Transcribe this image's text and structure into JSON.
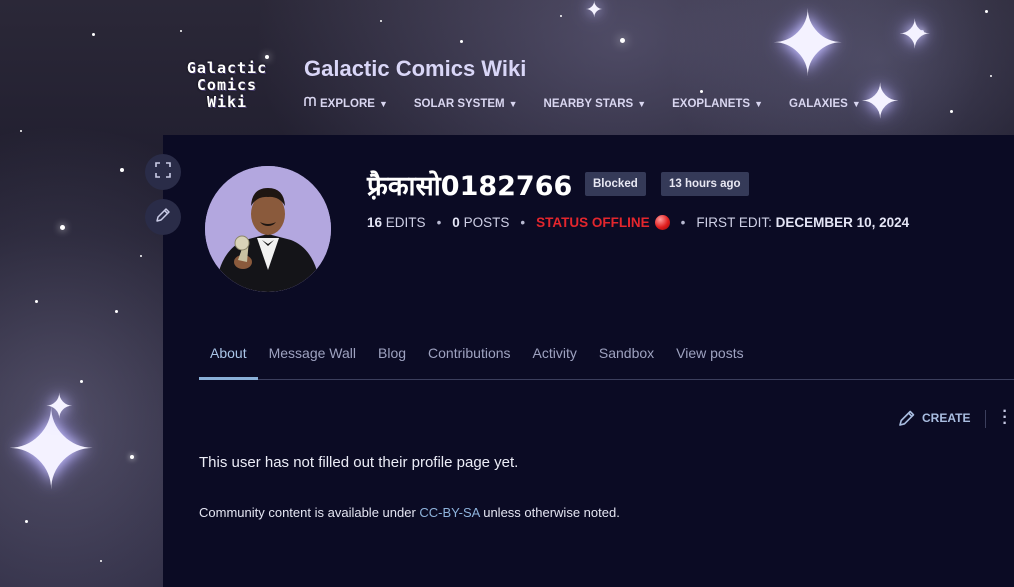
{
  "logo": {
    "line1": "Galactic",
    "line2": "Comics",
    "line3": "Wiki"
  },
  "site": {
    "title": "Galactic Comics Wiki"
  },
  "nav": {
    "items": [
      {
        "label": "EXPLORE",
        "icon": "explore-icon"
      },
      {
        "label": "SOLAR SYSTEM"
      },
      {
        "label": "NEARBY STARS"
      },
      {
        "label": "EXOPLANETS"
      },
      {
        "label": "GALAXIES"
      }
    ]
  },
  "profile": {
    "username": "फ़्रैकासो0182766",
    "badges": [
      "Blocked",
      "13 hours ago"
    ],
    "edits_count": "16",
    "edits_label": "EDITS",
    "posts_count": "0",
    "posts_label": "POSTS",
    "status": "STATUS OFFLINE",
    "status_color": "#e3262d",
    "first_edit_label": "FIRST EDIT:",
    "first_edit_date": "DECEMBER 10, 2024",
    "tools": [
      "fullscreen-icon",
      "edit-pencil-icon"
    ]
  },
  "tabs": [
    {
      "label": "About",
      "active": true
    },
    {
      "label": "Message Wall"
    },
    {
      "label": "Blog"
    },
    {
      "label": "Contributions"
    },
    {
      "label": "Activity"
    },
    {
      "label": "Sandbox"
    },
    {
      "label": "View posts"
    }
  ],
  "actions": {
    "create_label": "CREATE"
  },
  "content": {
    "empty_profile": "This user has not filled out their profile page yet.",
    "license_prefix": "Community content is available under ",
    "license_link": "CC-BY-SA",
    "license_suffix": " unless otherwise noted."
  },
  "colors": {
    "panel_bg": "#0b0b24",
    "accent": "#8ab0d8",
    "link": "#8eb3dc"
  }
}
